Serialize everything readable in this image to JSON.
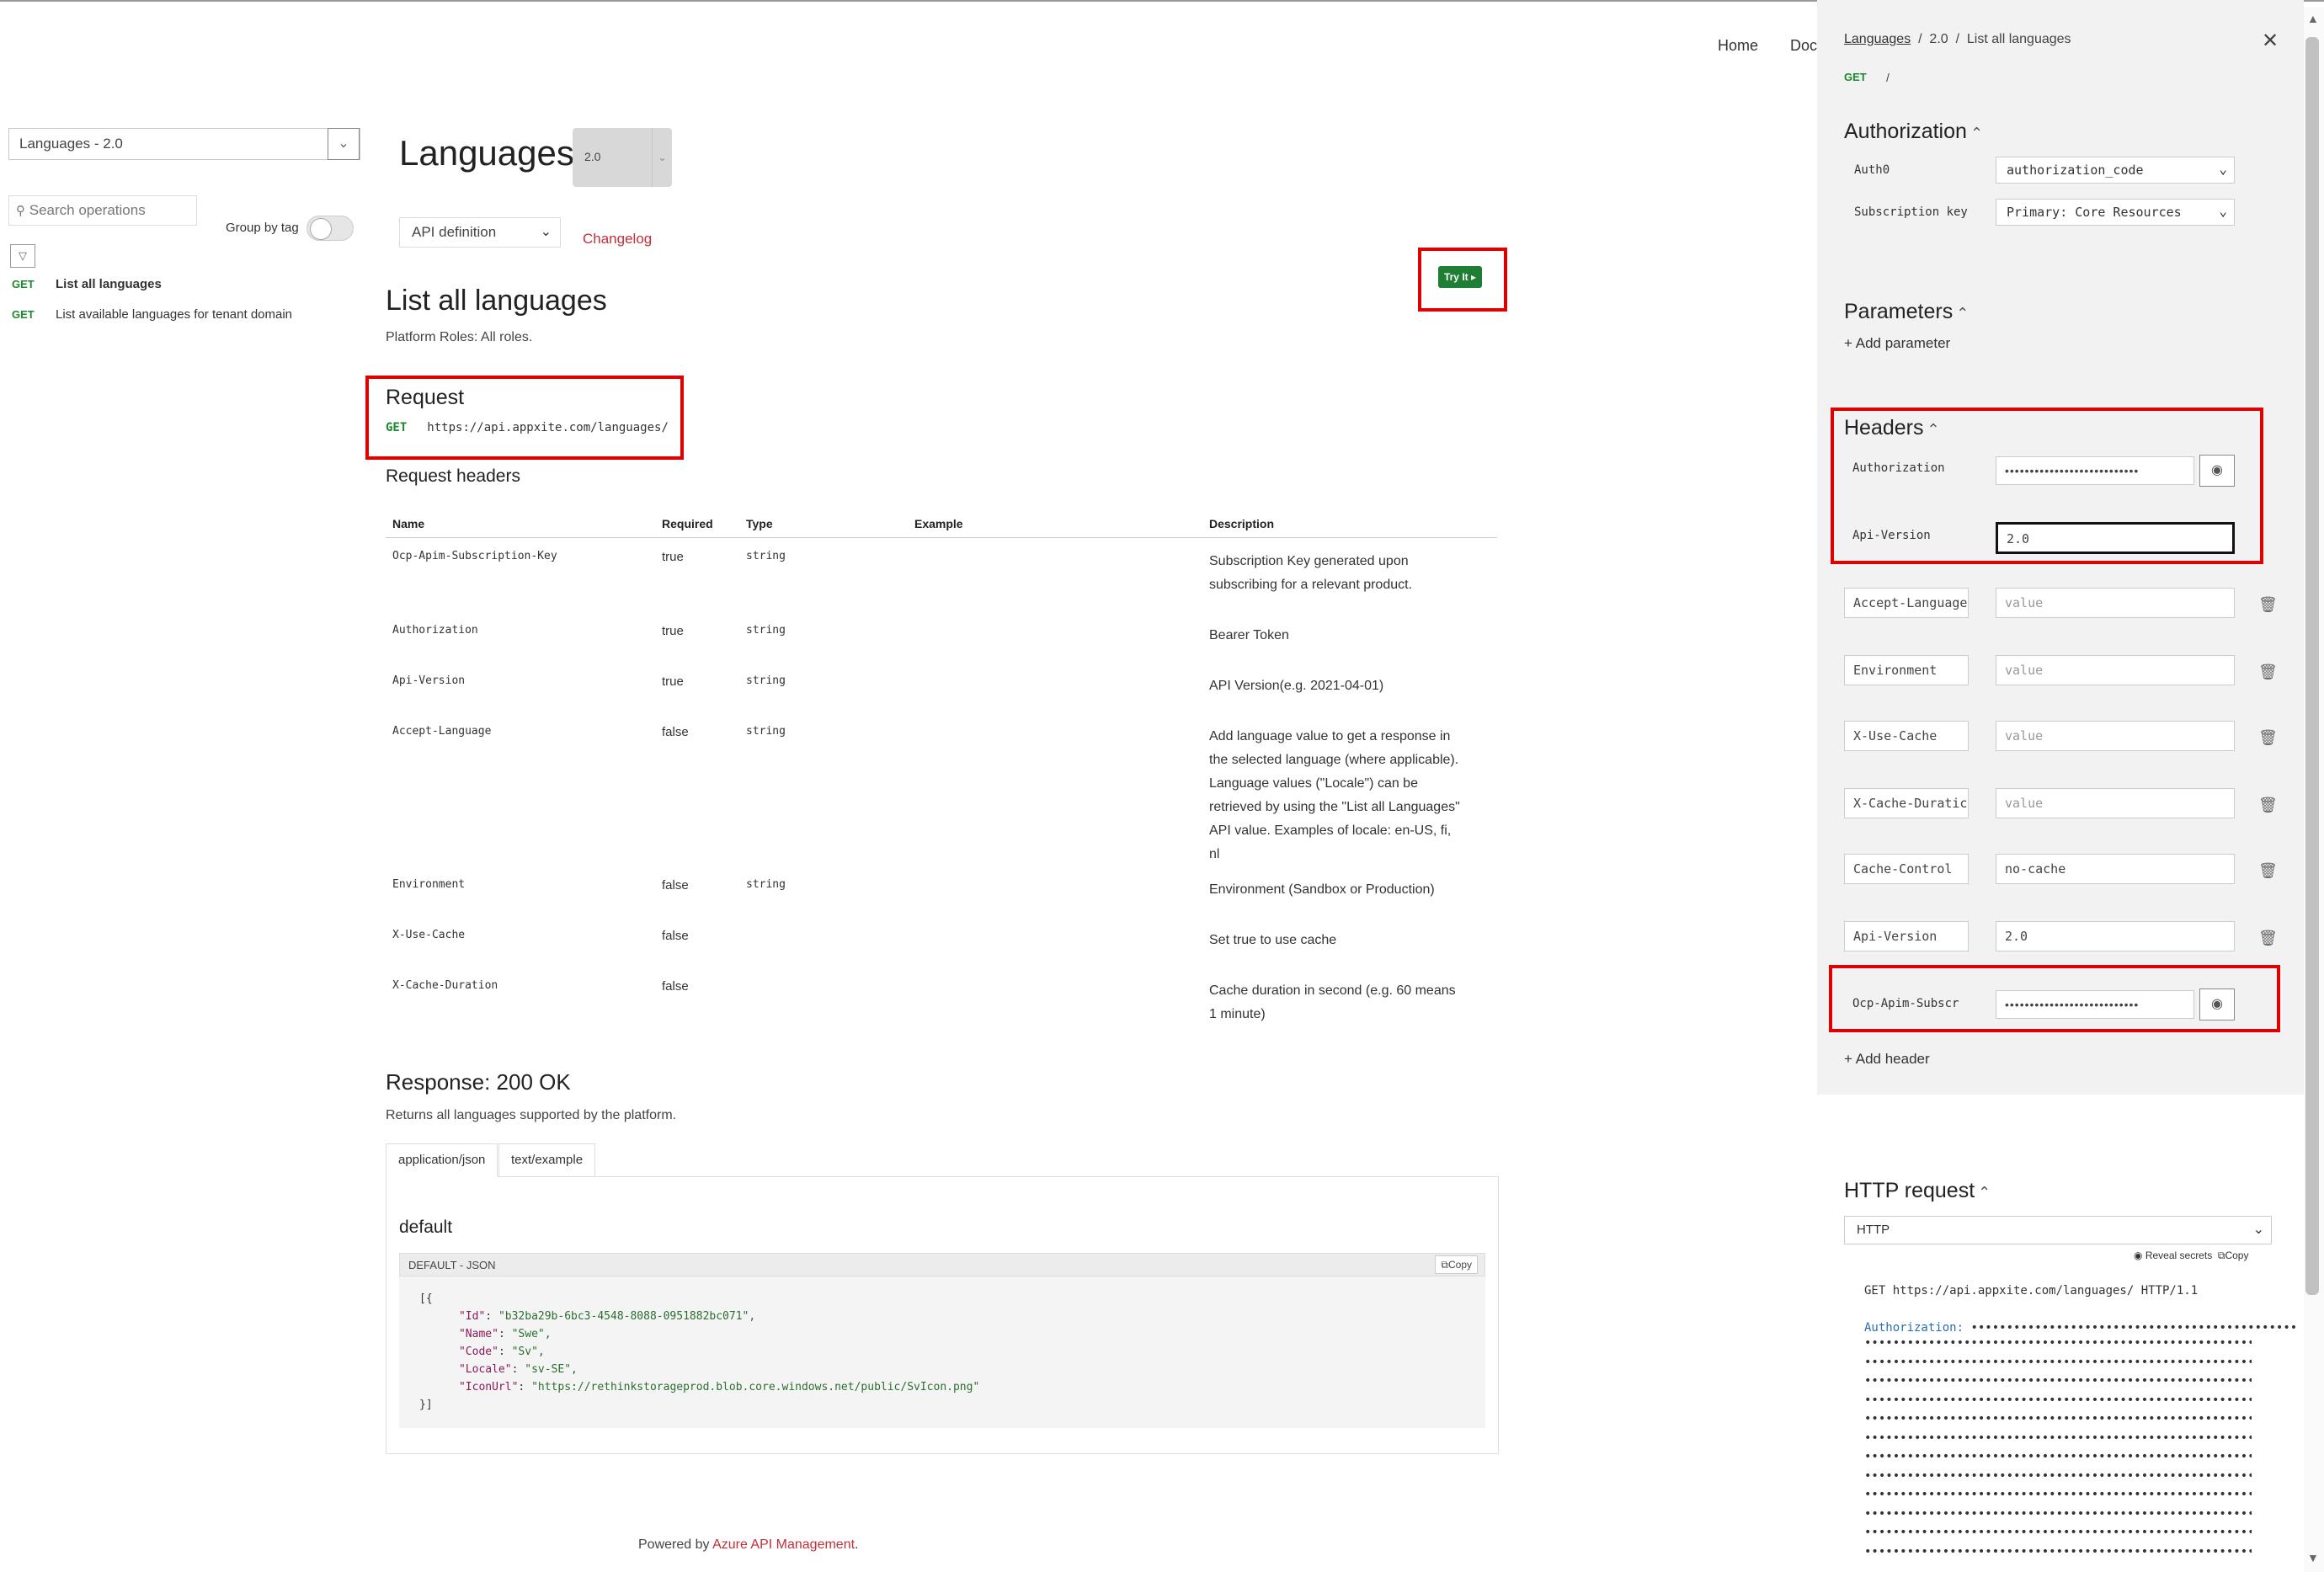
{
  "topnav": {
    "home": "Home",
    "docs": "Doc"
  },
  "sidebar": {
    "api_select": "Languages - 2.0",
    "search_placeholder": "Search operations",
    "group_by_tag": "Group by tag",
    "operations": [
      {
        "verb": "GET",
        "label": "List all languages"
      },
      {
        "verb": "GET",
        "label": "List available languages for tenant domain"
      }
    ]
  },
  "main": {
    "title": "Languages",
    "version": "2.0",
    "api_definition": "API definition",
    "changelog": "Changelog",
    "try_it": "Try It",
    "op_title": "List all languages",
    "roles": "Platform Roles: All roles.",
    "request_heading": "Request",
    "request_verb": "GET",
    "request_url": "https://api.appxite.com/languages/",
    "request_headers_heading": "Request headers",
    "table": {
      "headers": [
        "Name",
        "Required",
        "Type",
        "Example",
        "Description"
      ],
      "rows": [
        {
          "name": "Ocp-Apim-Subscription-Key",
          "required": "true",
          "type": "string",
          "example": "",
          "description": "Subscription Key generated upon subscribing for a relevant product."
        },
        {
          "name": "Authorization",
          "required": "true",
          "type": "string",
          "example": "",
          "description": "Bearer Token"
        },
        {
          "name": "Api-Version",
          "required": "true",
          "type": "string",
          "example": "",
          "description": "API Version(e.g. 2021-04-01)"
        },
        {
          "name": "Accept-Language",
          "required": "false",
          "type": "string",
          "example": "",
          "description": "Add language value to get a response in the selected language (where applicable). Language values (\"Locale\") can be retrieved by using the \"List all Languages\" API value. Examples of locale: en-US, fi, nl"
        },
        {
          "name": "Environment",
          "required": "false",
          "type": "string",
          "example": "",
          "description": "Environment (Sandbox or Production)"
        },
        {
          "name": "X-Use-Cache",
          "required": "false",
          "type": "",
          "example": "",
          "description": "Set true to use cache"
        },
        {
          "name": "X-Cache-Duration",
          "required": "false",
          "type": "",
          "example": "",
          "description": "Cache duration in second (e.g. 60 means 1 minute)"
        }
      ]
    },
    "response_heading": "Response: 200 OK",
    "response_sub": "Returns all languages supported by the platform.",
    "tabs": [
      "application/json",
      "text/example"
    ],
    "default_heading": "default",
    "code_bar": "DEFAULT - JSON",
    "copy": "Copy",
    "code": {
      "open": "[{",
      "lines": [
        {
          "k": "\"Id\"",
          "v": "\"b32ba29b-6bc3-4548-8088-0951882bc071\","
        },
        {
          "k": "\"Name\"",
          "v": "\"Swe\","
        },
        {
          "k": "\"Code\"",
          "v": "\"Sv\","
        },
        {
          "k": "\"Locale\"",
          "v": "\"sv-SE\","
        },
        {
          "k": "\"IconUrl\"",
          "v": "\"https://rethinkstorageprod.blob.core.windows.net/public/SvIcon.png\""
        }
      ],
      "close": "}]"
    },
    "powered_prefix": "Powered by ",
    "powered_link": "Azure API Management",
    "powered_suffix": "."
  },
  "panel": {
    "crumb_link": "Languages",
    "crumb_sep": "/",
    "crumb_version": "2.0",
    "crumb_op": "List all languages",
    "verb": "GET",
    "path": "/",
    "authorization_heading": "Authorization",
    "auth0_label": "Auth0",
    "auth0_value": "authorization_code",
    "sub_key_label": "Subscription key",
    "sub_key_value": "Primary: Core Resources",
    "parameters_heading": "Parameters",
    "add_parameter": "Add parameter",
    "headers_heading": "Headers",
    "headers": [
      {
        "key": "Authorization",
        "value": "•••••••••••••••••••••••••••",
        "kind": "secret"
      },
      {
        "key": "Api-Version",
        "value": "2.0",
        "kind": "focused"
      },
      {
        "key": "Accept-Language",
        "value": "value",
        "kind": "placeholder"
      },
      {
        "key": "Environment",
        "value": "value",
        "kind": "placeholder"
      },
      {
        "key": "X-Use-Cache",
        "value": "value",
        "kind": "placeholder"
      },
      {
        "key": "X-Cache-Duratic",
        "value": "value",
        "kind": "placeholder"
      },
      {
        "key": "Cache-Control",
        "value": "no-cache",
        "kind": "text"
      },
      {
        "key": "Api-Version",
        "value": "2.0",
        "kind": "text"
      },
      {
        "key": "Ocp-Apim-Subscr",
        "value": "•••••••••••••••••••••••••••",
        "kind": "secret"
      }
    ],
    "add_header": "Add header",
    "http_heading": "HTTP request",
    "http_select": "HTTP",
    "reveal_secrets": "Reveal secrets",
    "copy": "Copy",
    "http_line": "GET https://api.appxite.com/languages/ HTTP/1.1",
    "auth_key": "Authorization:",
    "masked": "••••••••••••••••••••••••••••••••••••••••••••••••••••••••••••••••••••••••"
  }
}
